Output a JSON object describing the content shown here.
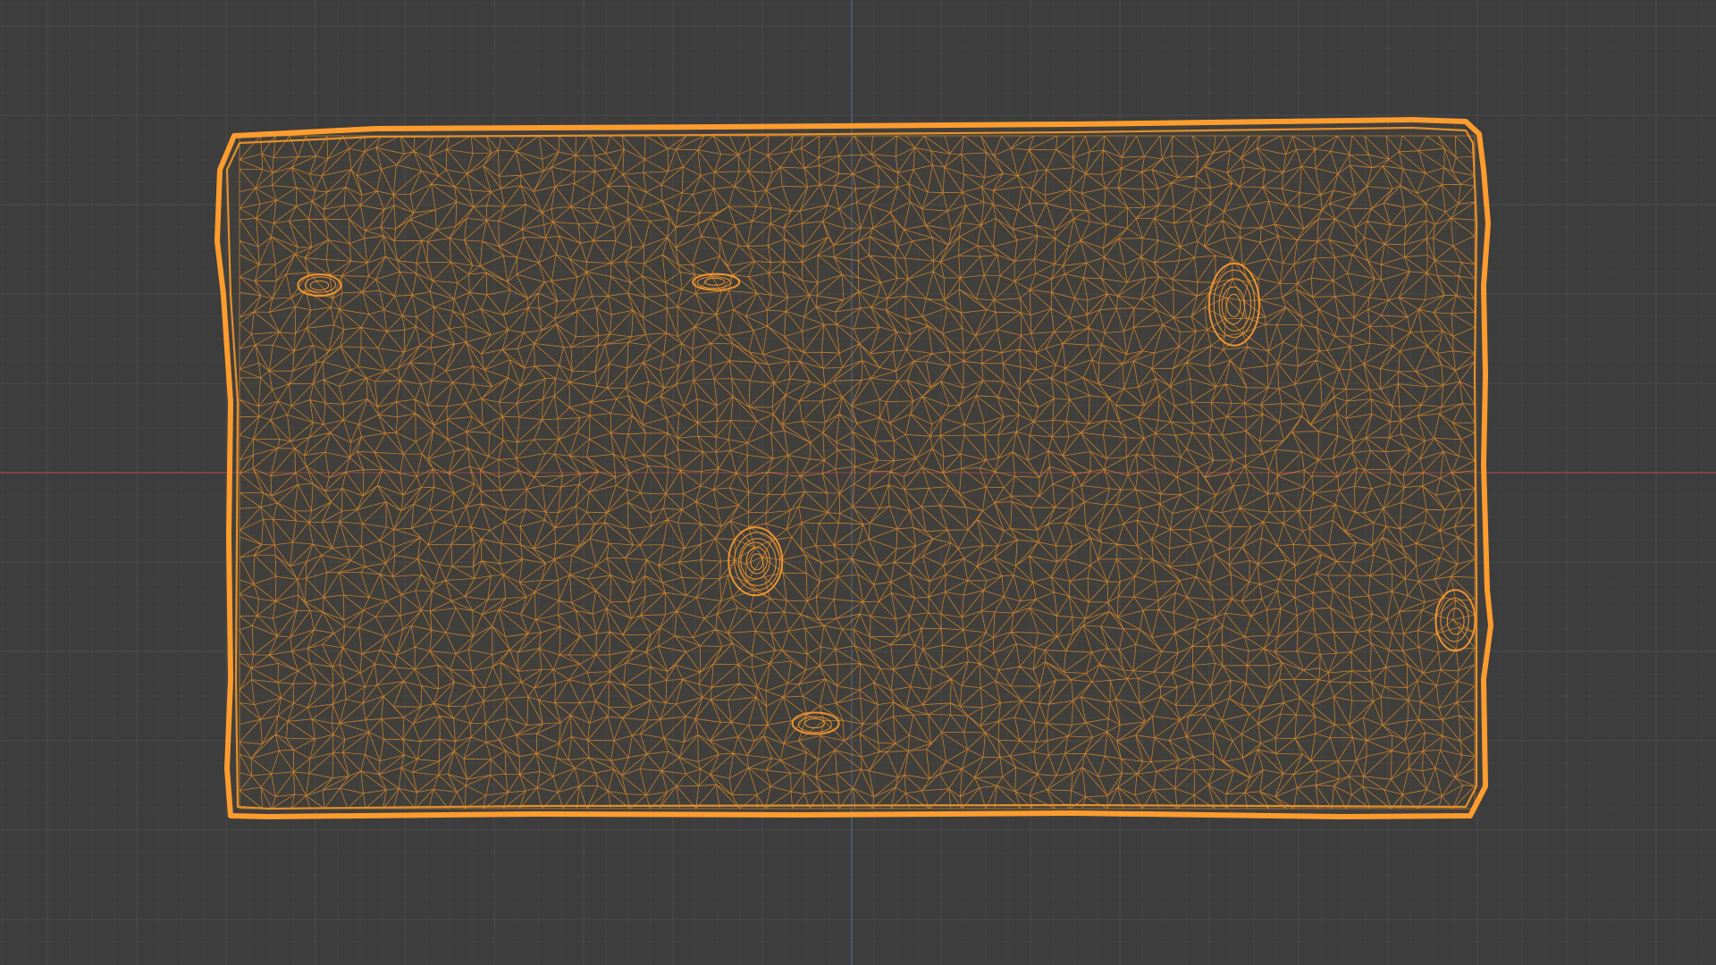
{
  "viewport": {
    "background_color": "#3d3d3d",
    "grid_minor_color": "#444444",
    "grid_major_color": "#4b4b4b",
    "x_axis_color": "#9a4a52",
    "y_axis_color": "#4e6c94"
  },
  "object": {
    "display_mode": "wireframe",
    "wire_color": "#e58f2a",
    "edge_highlight_color": "#ff9c2e",
    "features": [
      "hole-upper-right",
      "hole-center-left",
      "dent-upper-left",
      "dent-upper-center",
      "dent-bottom-center",
      "bump-right-edge"
    ]
  }
}
